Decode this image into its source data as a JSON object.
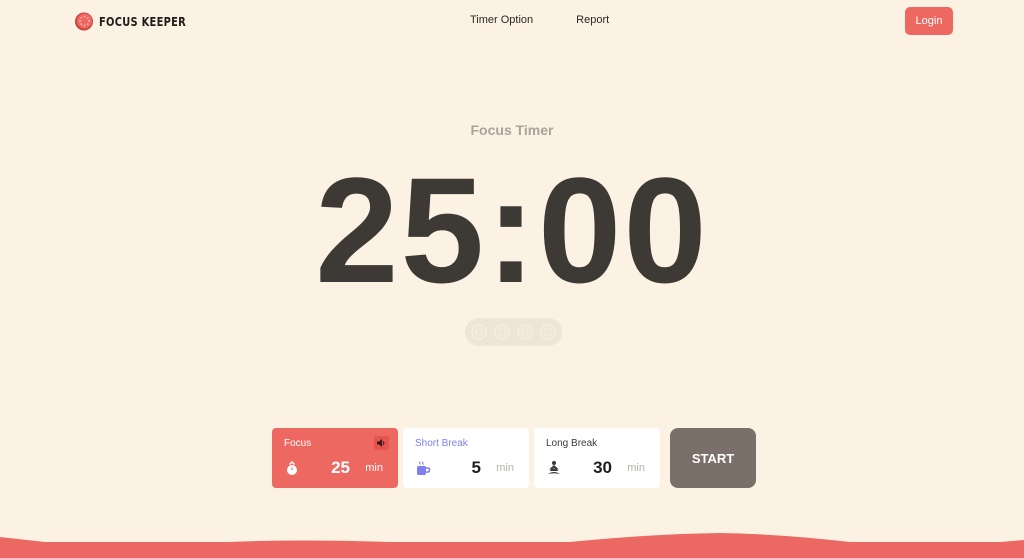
{
  "header": {
    "brand": "FOCUS KEEPER",
    "nav": [
      {
        "label": "Timer Option"
      },
      {
        "label": "Report"
      }
    ],
    "login_label": "Login"
  },
  "timer": {
    "mode_title": "Focus Timer",
    "display": "25:00",
    "sessions_total": 4,
    "sessions_completed": 0
  },
  "modes": [
    {
      "label": "Focus",
      "value": "25",
      "unit": "min",
      "icon": "stopwatch-icon",
      "active": true,
      "sound_icon": "speaker-icon"
    },
    {
      "label": "Short Break",
      "value": "5",
      "unit": "min",
      "icon": "coffee-cup-icon",
      "active": false
    },
    {
      "label": "Long Break",
      "value": "30",
      "unit": "min",
      "icon": "meditation-icon",
      "active": false
    }
  ],
  "start_label": "START",
  "colors": {
    "background": "#fcf2e3",
    "accent": "#ee6862",
    "short_break": "#7f7fef",
    "start_button": "#7a7069",
    "text_dark": "#3d3935"
  }
}
